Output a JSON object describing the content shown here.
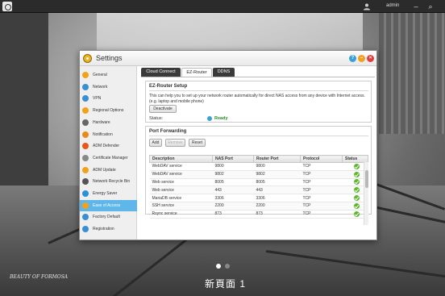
{
  "topbar": {
    "username": "admin"
  },
  "window": {
    "title": "Settings",
    "help_label": "?",
    "min_label": "–",
    "close_label": "×"
  },
  "sidebar": {
    "items": [
      {
        "label": "General",
        "icon": "gear-icon",
        "color": "#f2a21a"
      },
      {
        "label": "Network",
        "icon": "network-icon",
        "color": "#3a8fd0"
      },
      {
        "label": "VPN",
        "icon": "vpn-icon",
        "color": "#3a8fd0"
      },
      {
        "label": "Regional Options",
        "icon": "globe-icon",
        "color": "#f2a21a"
      },
      {
        "label": "Hardware",
        "icon": "hardware-icon",
        "color": "#666666"
      },
      {
        "label": "Notification",
        "icon": "notification-icon",
        "color": "#e88a1a"
      },
      {
        "label": "ADM Defender",
        "icon": "shield-icon",
        "color": "#e8561a"
      },
      {
        "label": "Certificate Manager",
        "icon": "certificate-icon",
        "color": "#888888"
      },
      {
        "label": "ADM Update",
        "icon": "update-icon",
        "color": "#f2a21a"
      },
      {
        "label": "Network Recycle Bin",
        "icon": "recycle-bin-icon",
        "color": "#555555"
      },
      {
        "label": "Energy Saver",
        "icon": "energy-icon",
        "color": "#2a90d8"
      },
      {
        "label": "Ease of Access",
        "icon": "ease-of-access-icon",
        "color": "#f2a21a"
      },
      {
        "label": "Factory Default",
        "icon": "factory-default-icon",
        "color": "#3a8fd0"
      },
      {
        "label": "Registration",
        "icon": "registration-icon",
        "color": "#3a8fd0"
      }
    ],
    "active_index": 11
  },
  "tabs": [
    {
      "label": "Cloud Connect"
    },
    {
      "label": "EZ-Router"
    },
    {
      "label": "DDNS"
    }
  ],
  "ezrouter": {
    "title": "EZ-Router Setup",
    "description": "This can help you to set up your network router automatically for direct NAS access from any device with Internet access. (e.g. laptop and mobile phone)",
    "deactivate_label": "Deactivate",
    "status_label": "Status:",
    "status_value": "Ready"
  },
  "port_forwarding": {
    "title": "Port Forwarding",
    "add_label": "Add",
    "remove_label": "Remove",
    "reset_label": "Reset",
    "columns": [
      "Description",
      "NAS Port",
      "Router Port",
      "Protocol",
      "Status"
    ],
    "rows": [
      [
        "WebDAV service",
        "9800",
        "9800",
        "TCP"
      ],
      [
        "WebDAV service",
        "9802",
        "9802",
        "TCP"
      ],
      [
        "Web service",
        "8005",
        "8005",
        "TCP"
      ],
      [
        "Web service",
        "443",
        "443",
        "TCP"
      ],
      [
        "MariaDB service",
        "3306",
        "3306",
        "TCP"
      ],
      [
        "SSH service",
        "2200",
        "2200",
        "TCP"
      ],
      [
        "Rsync service",
        "873",
        "873",
        "TCP"
      ]
    ]
  },
  "desktop": {
    "page_label": "新頁面 1",
    "watermark": "BEAUTY OF FORMOSA"
  },
  "colors": {
    "accent": "#5fb6e8",
    "ok_green": "#5cb82a",
    "tab_dark": "#3a3a3a"
  }
}
